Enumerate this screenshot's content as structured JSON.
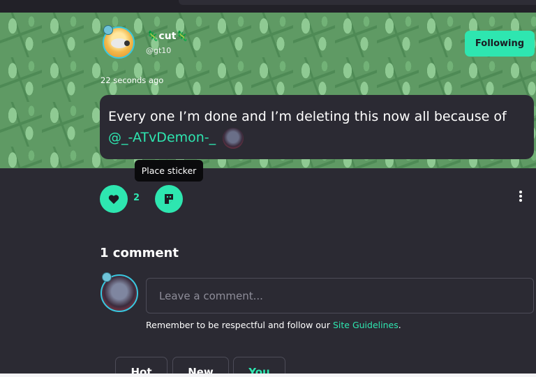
{
  "post": {
    "author_display_name": "🦎cut🦎",
    "author_username": "@gt10",
    "follow_label": "Following",
    "timestamp": "22 seconds ago",
    "text": "Every one I’m done and I’m deleting this now all because of",
    "mention": "@_-ATvDemon-_",
    "like_count": "2",
    "tooltip": "Place sticker"
  },
  "comments": {
    "title": "1 comment",
    "input_placeholder": "Leave a comment...",
    "guidelines_prefix": "Remember to be respectful and follow our ",
    "guidelines_link": "Site Guidelines",
    "guidelines_suffix": ".",
    "sort_tabs": [
      {
        "label": "Hot"
      },
      {
        "label": "New"
      },
      {
        "label": "You"
      }
    ],
    "active_tab": "You"
  },
  "colors": {
    "accent": "#2ee6b0",
    "background": "#2b2a33",
    "tooltip_bg": "#0a0a0c"
  },
  "icons": [
    "heart-icon",
    "sticker-icon",
    "kebab-menu-icon"
  ]
}
